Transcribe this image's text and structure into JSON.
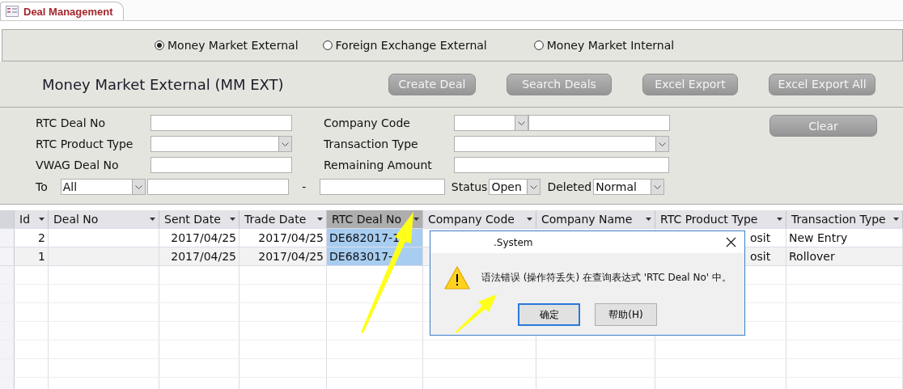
{
  "tab": {
    "title": "Deal Management"
  },
  "market_options": [
    {
      "label": "Money Market External",
      "selected": true
    },
    {
      "label": "Foreign Exchange External",
      "selected": false
    },
    {
      "label": "Money Market Internal",
      "selected": false
    }
  ],
  "heading": "Money Market External (MM EXT)",
  "actions": [
    "Create Deal",
    "Search Deals",
    "Excel Export",
    "Excel Export All"
  ],
  "filters": {
    "rtc_deal_no": {
      "label": "RTC Deal No"
    },
    "rtc_product_type": {
      "label": "RTC Product Type"
    },
    "vwag_deal_no": {
      "label": "VWAG Deal No"
    },
    "company_code": {
      "label": "Company Code"
    },
    "transaction_type": {
      "label": "Transaction Type"
    },
    "remaining_amount": {
      "label": "Remaining Amount"
    },
    "to": {
      "label": "To",
      "value": "All"
    },
    "range_separator": "-",
    "status": {
      "label": "Status",
      "value": "Open"
    },
    "deleted": {
      "label": "Deleted",
      "value": "Normal"
    }
  },
  "clear_button": "Clear",
  "table": {
    "columns": [
      {
        "label": "Id",
        "selected": false
      },
      {
        "label": "Deal No",
        "selected": false
      },
      {
        "label": "Sent Date",
        "selected": false
      },
      {
        "label": "Trade Date",
        "selected": false
      },
      {
        "label": "RTC Deal No",
        "selected": true
      },
      {
        "label": "Company Code",
        "selected": false
      },
      {
        "label": "Company Name",
        "selected": false
      },
      {
        "label": "RTC Product Type",
        "selected": false
      },
      {
        "label": "Transaction Type",
        "selected": false
      }
    ],
    "rows": [
      {
        "selected": false,
        "cells": [
          "2",
          null,
          "2017/04/25",
          "2017/04/25",
          "DE682017-1",
          null,
          null,
          "osit",
          "New Entry"
        ]
      },
      {
        "selected": true,
        "cells": [
          "1",
          null,
          "2017/04/25",
          "2017/04/25",
          "DE683017-",
          null,
          null,
          "osit",
          "Rollover"
        ]
      }
    ]
  },
  "dialog": {
    "title": ".System",
    "message": "语法错误 (操作符丢失) 在查询表达式 'RTC Deal No' 中。",
    "buttons": [
      {
        "label": "确定",
        "default": true
      },
      {
        "label": "帮助(H)",
        "default": false
      }
    ]
  }
}
